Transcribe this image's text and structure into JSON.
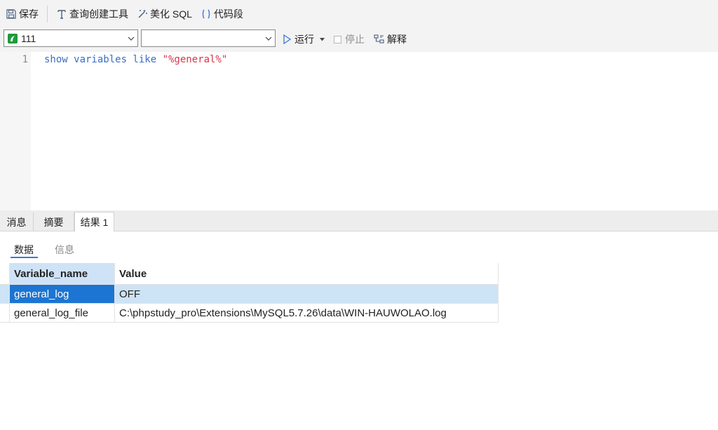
{
  "toolbar1": {
    "save": "保存",
    "query_builder": "查询创建工具",
    "beautify": "美化 SQL",
    "snippet": "代码段"
  },
  "toolbar2": {
    "connection_value": "111",
    "database_value": "",
    "run": "运行",
    "stop": "停止",
    "explain": "解释"
  },
  "editor": {
    "line_number": "1",
    "code_keywords": "show variables like ",
    "code_string": "\"%general%\""
  },
  "result_tabs": [
    "消息",
    "摘要",
    "结果 1"
  ],
  "sub_tabs": [
    "数据",
    "信息"
  ],
  "grid": {
    "headers": [
      "Variable_name",
      "Value"
    ],
    "rows": [
      [
        "general_log",
        "OFF"
      ],
      [
        "general_log_file",
        "C:\\phpstudy_pro\\Extensions\\MySQL5.7.26\\data\\WIN-HAUWOLAO.log"
      ]
    ]
  },
  "colors": {
    "accent": "#1c75d2",
    "selection": "#cde3f6",
    "keyword": "#3a6fc4",
    "string": "#d7364b"
  }
}
